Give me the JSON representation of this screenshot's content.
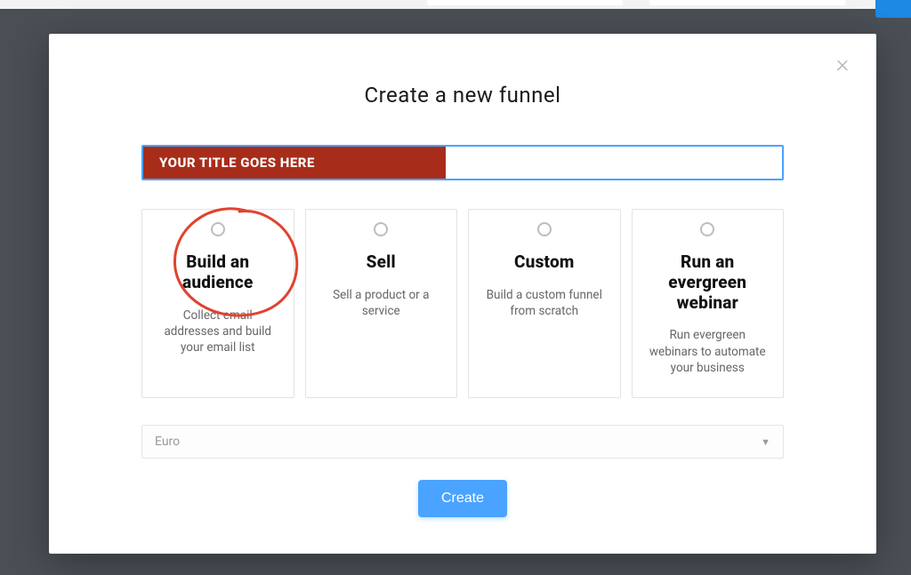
{
  "modal": {
    "title": "Create a new funnel",
    "close_label": "×",
    "title_input": {
      "badge": "YOUR TITLE GOES HERE",
      "value": ""
    },
    "options": [
      {
        "title": "Build an audience",
        "desc": "Collect email addresses and build your email list"
      },
      {
        "title": "Sell",
        "desc": "Sell a product or a service"
      },
      {
        "title": "Custom",
        "desc": "Build a custom funnel from scratch"
      },
      {
        "title": "Run an evergreen webinar",
        "desc": "Run evergreen webinars to automate your business"
      }
    ],
    "currency": {
      "selected": "Euro"
    },
    "create_label": "Create"
  }
}
